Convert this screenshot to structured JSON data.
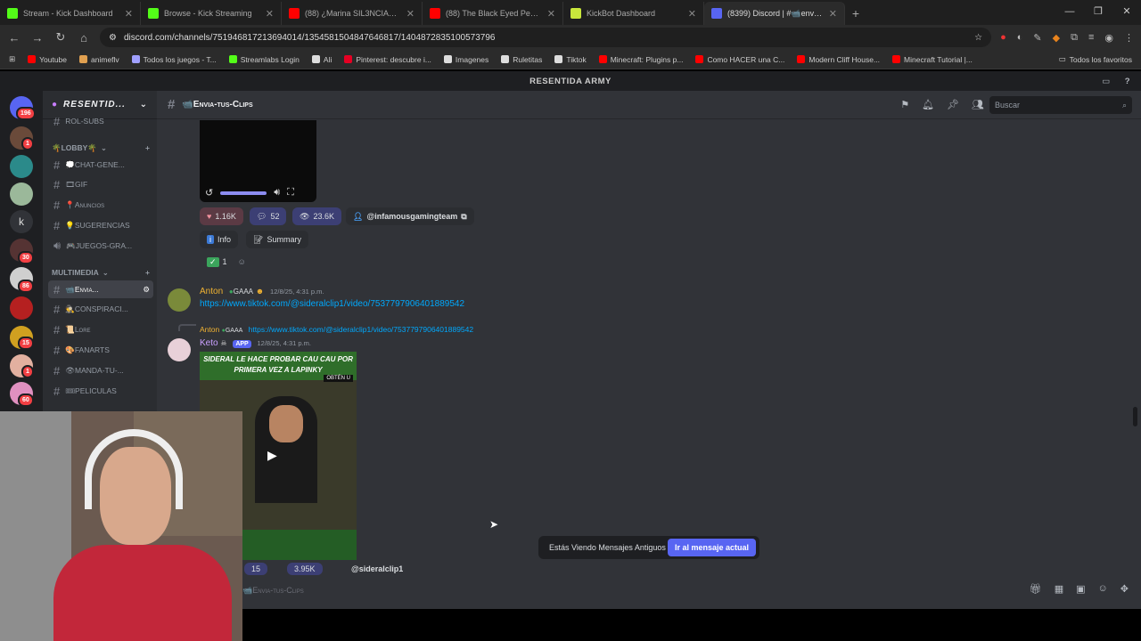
{
  "browser": {
    "tabs": [
      {
        "label": "Stream - Kick Dashboard",
        "color": "#53fc18",
        "active": false
      },
      {
        "label": "Browse - Kick Streaming",
        "color": "#53fc18",
        "active": false
      },
      {
        "label": "(88) ¿Marina SIL3NCIADA?",
        "color": "#ff0000",
        "active": false
      },
      {
        "label": "(88) The Black Eyed Peas - Don",
        "color": "#ff0000",
        "active": false
      },
      {
        "label": "KickBot Dashboard",
        "color": "#c8e63c",
        "active": false
      },
      {
        "label": "(8399) Discord | #📹envia-tus",
        "color": "#5865f2",
        "active": true
      }
    ],
    "url": "discord.com/channels/751946817213694014/1354581504847646817/1404872835100573796",
    "bookmarks": [
      "Youtube",
      "animeflv",
      "Todos los juegos - T...",
      "Streamlabs Login",
      "Ali",
      "Pinterest: descubre i...",
      "Imagenes",
      "Ruletitas",
      "Tiktok",
      "Minecraft: Plugins p...",
      "Como HACER una C...",
      "Modern Cliff House...",
      "Minecraft Tutorial |..."
    ],
    "bookmarks_right": "Todos los favoritos"
  },
  "discord": {
    "window_title": "RESENTIDA ARMY",
    "server_name": "RESENTID...",
    "rail_badges": [
      "196",
      "1",
      "30",
      "86",
      "15",
      "1",
      "60"
    ],
    "categories": [
      {
        "label": "🌴LOBBY🌴"
      },
      {
        "label": "MULTIMEDIA"
      }
    ],
    "channels_top": [
      "ROL-SUBS"
    ],
    "channels_lobby": [
      "💭CHAT-GENE...",
      "🎞GIF",
      "📍Anuncios",
      "💡SUGERENCIAS",
      "🎮JUEGOS-GRA..."
    ],
    "channels_multi": [
      "📹Envia...",
      "🕵CONSPIRACI...",
      "📜Lore",
      "🎨FANARTS",
      "👁MANDA-TU-...",
      "🎟PELICULAS"
    ],
    "channel_title": "📹Envia-tus-Clips",
    "search_placeholder": "Buscar",
    "embed": {
      "likes": "1.16K",
      "comments": "52",
      "views": "23.6K",
      "author": "@infamousgamingteam",
      "info_label": "Info",
      "summary_label": "Summary",
      "reaction_count": "1"
    },
    "messages": [
      {
        "user": "Anton",
        "tag": "GAAA",
        "time": "12/8/25, 4:31 p.m.",
        "text": "https://www.tiktok.com/@sideralclip1/video/7537797906401889542"
      },
      {
        "user": "Keto",
        "app": "APP",
        "time": "12/8/25, 4:31 p.m.",
        "reply_user": "Anton",
        "reply_tag": "GAAA",
        "reply_text": "https://www.tiktok.com/@sideralclip1/video/7537797906401889542"
      }
    ],
    "thumbnail_caption": "SIDERAL LE HACE PROBAR CAU CAU POR PRIMERA VEZ A LAPINKY",
    "thumbnail_badge": "OBTÉN U",
    "embed2": {
      "comments": "15",
      "views": "3.95K",
      "author": "@sideralclip1"
    },
    "toast": {
      "text": "Estás Viendo Mensajes Antiguos",
      "button": "Ir al mensaje actual"
    },
    "composer_placeholder": "📹Envia-tus-Clips"
  }
}
